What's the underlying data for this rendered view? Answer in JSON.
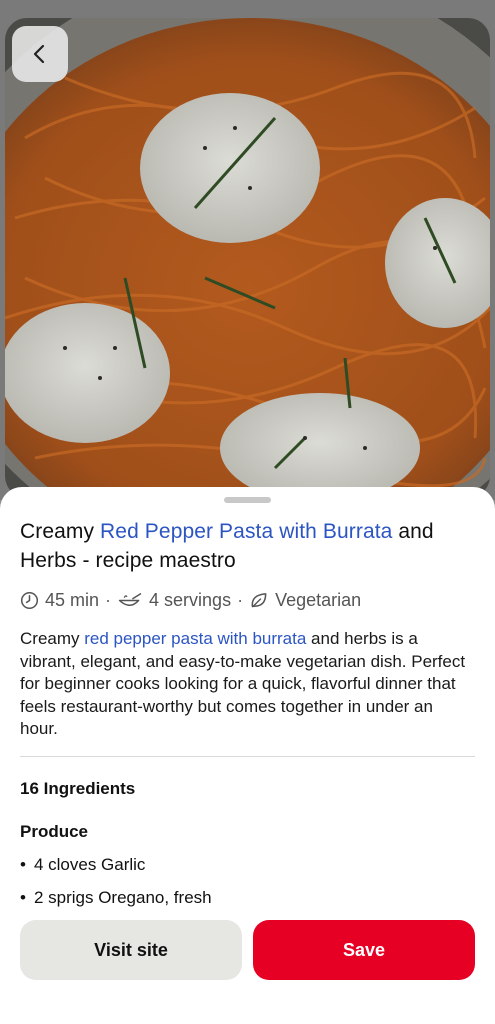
{
  "navigation": {
    "back_icon": "chevron-left-icon"
  },
  "pin": {
    "title_parts": [
      "Creamy ",
      "Red Pepper Pasta with Burrata",
      " and Herbs - recipe maestro"
    ],
    "meta": {
      "time": "45 min",
      "servings": "4 servings",
      "diet": "Vegetarian",
      "separator": "·"
    },
    "description_parts": [
      "Creamy ",
      "red pepper pasta with burrata",
      " and herbs is a vibrant, elegant, and easy-to-make vegetarian dish. Perfect for beginner cooks looking for a quick, flavorful dinner that feels restaurant-worthy but comes together in under an hour."
    ]
  },
  "ingredients": {
    "count_label": "16 Ingredients",
    "section": "Produce",
    "items": [
      "4 cloves Garlic",
      "2 sprigs Oregano, fresh"
    ],
    "bullet": "•"
  },
  "actions": {
    "visit_label": "Visit site",
    "save_label": "Save"
  },
  "colors": {
    "link": "#2b55c2",
    "save": "#e60023",
    "visit": "#e6e6e3"
  }
}
